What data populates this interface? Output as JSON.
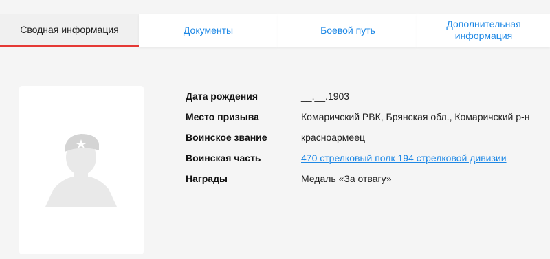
{
  "tabs": [
    {
      "label": "Сводная информация",
      "active": true
    },
    {
      "label": "Документы",
      "active": false
    },
    {
      "label": "Боевой путь",
      "active": false
    },
    {
      "label": "Дополнительная\nинформация",
      "active": false
    }
  ],
  "colors": {
    "accent_red": "#e53935",
    "link_blue": "#1e88e5",
    "background": "#f5f5f5"
  },
  "photo": {
    "icon": "soldier-silhouette-icon"
  },
  "info": {
    "birth_date_label": "Дата рождения",
    "birth_date_value": "__.__.1903",
    "conscription_place_label": "Место призыва",
    "conscription_place_value": "Комаричский РВК, Брянская обл., Комаричский р-н",
    "rank_label": "Воинское звание",
    "rank_value": "красноармеец",
    "unit_label": "Воинская часть",
    "unit_value": "470 стрелковый полк 194 стрелковой дивизии",
    "awards_label": "Награды",
    "awards_value": "Медаль «За отвагу»"
  }
}
